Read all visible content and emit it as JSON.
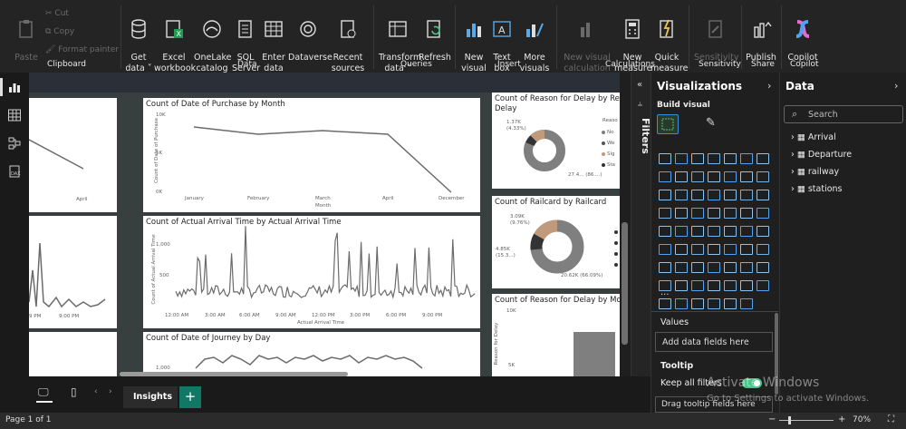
{
  "ribbon": {
    "clipboard": {
      "paste": "Paste",
      "cut": "Cut",
      "copy": "Copy",
      "format_painter": "Format painter",
      "group": "Clipboard"
    },
    "data": {
      "get_data": "Get\ndata ˅",
      "excel": "Excel\nworkbook",
      "onelake": "OneLake\ncatalog ˅",
      "sql": "SQL\nServer",
      "enter": "Enter\ndata",
      "dataverse": "Dataverse",
      "recent": "Recent\nsources ˅",
      "group": "Data"
    },
    "queries": {
      "transform": "Transform\ndata ˅",
      "refresh": "Refresh",
      "group": "Queries"
    },
    "insert": {
      "new_visual": "New\nvisual",
      "text_box": "Text\nbox",
      "more_visuals": "More\nvisuals ˅",
      "group": "Insert"
    },
    "calculations": {
      "new_visual_calc": "New visual\ncalculation",
      "new_measure": "New\nmeasure",
      "quick_measure": "Quick\nmeasure",
      "group": "Calculations"
    },
    "sensitivity": {
      "label": "Sensitivity\n˅",
      "group": "Sensitivity"
    },
    "share": {
      "publish": "Publish",
      "group": "Share"
    },
    "copilot": {
      "label": "Copilot",
      "group": "Copilot"
    }
  },
  "cards": {
    "purchase": {
      "title": "Count of Date of Purchase by Month",
      "yticks": [
        "10K",
        "5K",
        "0K"
      ],
      "ylabel": "Count of Date of Purchase",
      "xticks": [
        "January",
        "February",
        "March",
        "April",
        "December"
      ],
      "xlabel": "Month"
    },
    "arrival": {
      "title": "Count of Actual Arrival Time by Actual Arrival Time",
      "yticks": [
        "1,000",
        "500"
      ],
      "ylabel": "Count of Actual Arrival Time",
      "xticks": [
        "12:00 AM",
        "3:00 AM",
        "6:00 AM",
        "9:00 AM",
        "12:00 PM",
        "3:00 PM",
        "6:00 PM",
        "9:00 PM"
      ],
      "xlabel": "Actual Arrival Time"
    },
    "journey": {
      "title": "Count of Date of Journey by Day",
      "yticks": [
        "1,000"
      ],
      "ylabel": "Journey"
    },
    "left_top": {
      "xtick": "April"
    },
    "left_mid": {
      "xticks": [
        "9 PM",
        "9:00 PM"
      ]
    },
    "delay": {
      "title": "Count of Reason for Delay by Reason for",
      "title2": "Delay",
      "legend_title": "Reaso",
      "legend": [
        "No",
        "We",
        "Sig",
        "Sta"
      ],
      "label1": "1.37K\n(4.33%)",
      "label2": "27.4... (86....)"
    },
    "railcard": {
      "title": "Count of Railcard by Railcard",
      "label1": "3.09K\n(9.76%)",
      "label2": "4.85K\n(15.3...)",
      "label3": "20.62K (66.09%)"
    },
    "delay_mon": {
      "title": "Count of Reason for Delay by Mon",
      "yticks": [
        "10K",
        "5K"
      ],
      "ylabel": "Reason for Delay"
    }
  },
  "filters": {
    "label": "Filters"
  },
  "visualizations": {
    "title": "Visualizations",
    "build": "Build visual",
    "values": "Values",
    "add_fields": "Add data fields here",
    "tooltip": "Tooltip",
    "keep_filters": "Keep all filters",
    "drag": "Drag tooltip fields here",
    "more": "···"
  },
  "data_pane": {
    "title": "Data",
    "search_placeholder": "Search",
    "tables": [
      "Arrival",
      "Departure",
      "railway",
      "stations"
    ]
  },
  "tabs": {
    "page": "Insights",
    "add": "+"
  },
  "status": {
    "page": "Page 1 of 1",
    "zoom": "70%"
  },
  "watermark": {
    "line1": "Activate Windows",
    "line2": "Go to Settings to activate Windows."
  },
  "colors": {
    "accent": "#0f6cbd",
    "toggle": "#4cc38a",
    "chart_line": "#6b6b6b",
    "donut_main": "#7f7f7f",
    "donut_accent": "#c19a7c"
  }
}
